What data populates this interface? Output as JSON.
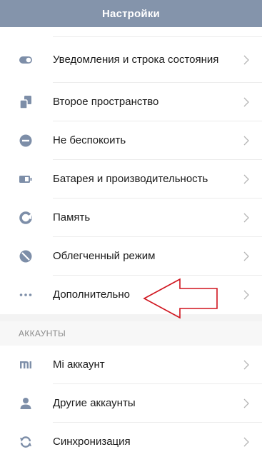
{
  "header": {
    "title": "Настройки"
  },
  "items": [
    {
      "label": "Уведомления и строка состояния",
      "icon": "toggle-icon"
    },
    {
      "label": "Второе пространство",
      "icon": "dual-space-icon"
    },
    {
      "label": "Не беспокоить",
      "icon": "do-not-disturb-icon"
    },
    {
      "label": "Батарея и производительность",
      "icon": "battery-icon"
    },
    {
      "label": "Память",
      "icon": "storage-pie-icon"
    },
    {
      "label": "Облегченный режим",
      "icon": "lite-mode-icon"
    },
    {
      "label": "Дополнительно",
      "icon": "more-dots-icon"
    }
  ],
  "accounts_section": {
    "header": "АККАУНТЫ",
    "items": [
      {
        "label": "Mi аккаунт",
        "icon": "mi-logo-icon"
      },
      {
        "label": "Другие аккаунты",
        "icon": "person-icon"
      },
      {
        "label": "Синхронизация",
        "icon": "sync-icon"
      }
    ]
  },
  "colors": {
    "header_bg": "#8494ab",
    "icon": "#7d8ea8",
    "annotation_arrow": "#d0141e"
  }
}
